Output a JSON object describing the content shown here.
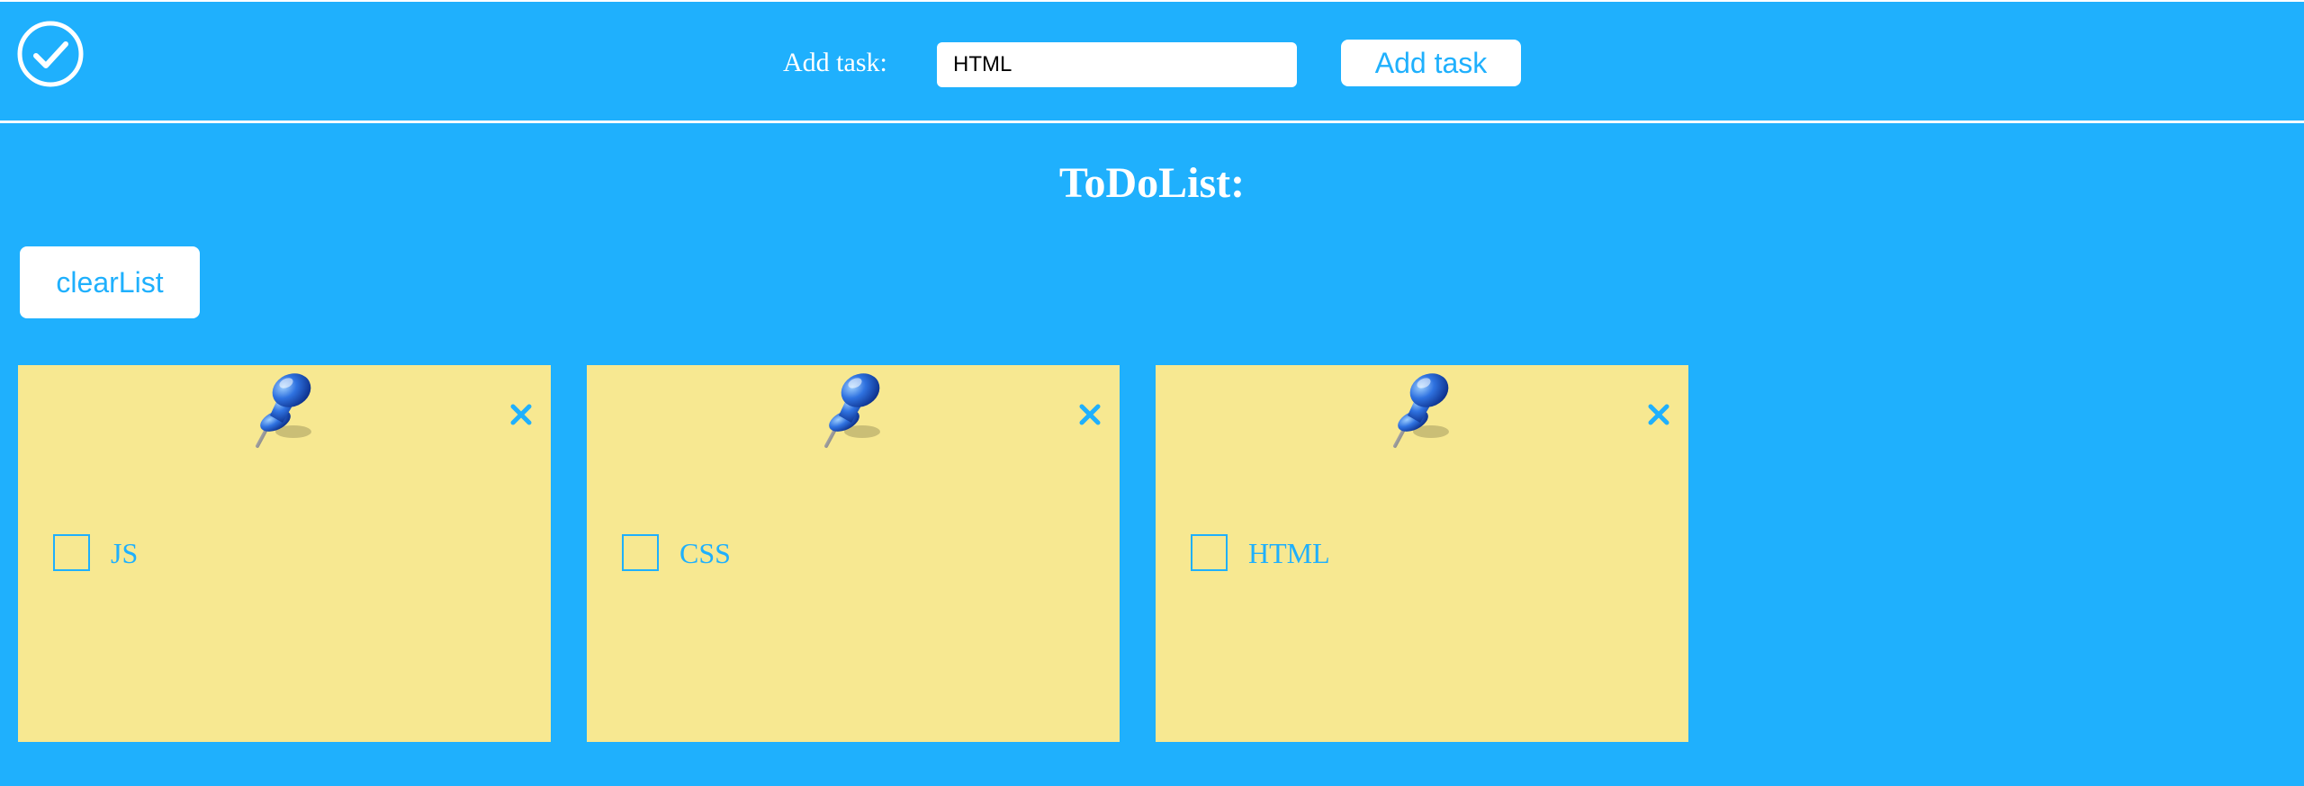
{
  "header": {
    "logo_icon": "check-circle-icon",
    "add_label": "Add task:",
    "task_input_value": "HTML",
    "add_button_label": "Add task"
  },
  "main": {
    "title": "ToDoList:",
    "clear_button_label": "clearList"
  },
  "tasks": [
    {
      "label": "JS",
      "checked": false,
      "pin_icon": "pushpin-icon",
      "close_icon": "close-icon"
    },
    {
      "label": "CSS",
      "checked": false,
      "pin_icon": "pushpin-icon",
      "close_icon": "close-icon"
    },
    {
      "label": "HTML",
      "checked": false,
      "pin_icon": "pushpin-icon",
      "close_icon": "close-icon"
    }
  ],
  "colors": {
    "background": "#1fb0fd",
    "card": "#f7e891",
    "accent": "#1fb0fd",
    "white": "#ffffff",
    "pin": "#1e5bd0"
  }
}
